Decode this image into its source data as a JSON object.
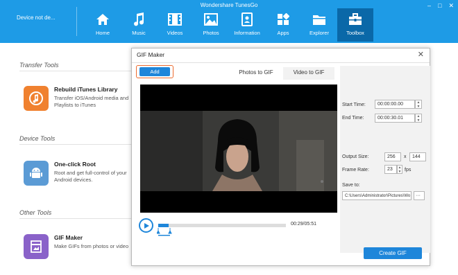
{
  "app": {
    "title": "Wondershare TunesGo",
    "device": "Device not de...",
    "win_controls": [
      "‒",
      "□",
      "✕"
    ]
  },
  "nav": [
    {
      "label": "Home",
      "icon": "home-icon"
    },
    {
      "label": "Music",
      "icon": "music-icon"
    },
    {
      "label": "Videos",
      "icon": "videos-icon"
    },
    {
      "label": "Photos",
      "icon": "photos-icon"
    },
    {
      "label": "Information",
      "icon": "information-icon"
    },
    {
      "label": "Apps",
      "icon": "apps-icon"
    },
    {
      "label": "Explorer",
      "icon": "explorer-icon"
    },
    {
      "label": "Toolbox",
      "icon": "toolbox-icon",
      "active": true
    }
  ],
  "sections": {
    "transfer": "Transfer Tools",
    "device": "Device Tools",
    "other": "Other Tools"
  },
  "tools": {
    "rebuild": {
      "name": "Rebuild iTunes Library",
      "desc": "Transfer iOS/Android media and Playlists to iTunes"
    },
    "root": {
      "name": "One-click Root",
      "desc": "Root and get full-control of your Android devices."
    },
    "gif": {
      "name": "GIF Maker",
      "desc": "Make GIFs from photos or video"
    }
  },
  "dialog": {
    "title": "GIF Maker",
    "close": "✕",
    "add_label": "Add",
    "tabs": [
      "Photos to GIF",
      "Video to GIF"
    ],
    "time_display": "00:29/05:51",
    "progress_fraction": 0.083,
    "start_time_label": "Start Time:",
    "start_time": "00:00:00.00",
    "end_time_label": "End Time:",
    "end_time": "00:00:30.01",
    "output_size_label": "Output Size:",
    "width": "256",
    "times": "x",
    "height": "144",
    "frame_rate_label": "Frame Rate:",
    "frame_rate": "23",
    "fps": "fps",
    "save_to_label": "Save to:",
    "save_path": "C:\\Users\\Administrator\\Pictures\\Wo",
    "browse": "···",
    "create_label": "Create GIF"
  },
  "colors": {
    "accent": "#1e9be6",
    "active_tab": "#0a68a8",
    "button": "#1e86da",
    "highlight": "#ec6b2e"
  }
}
